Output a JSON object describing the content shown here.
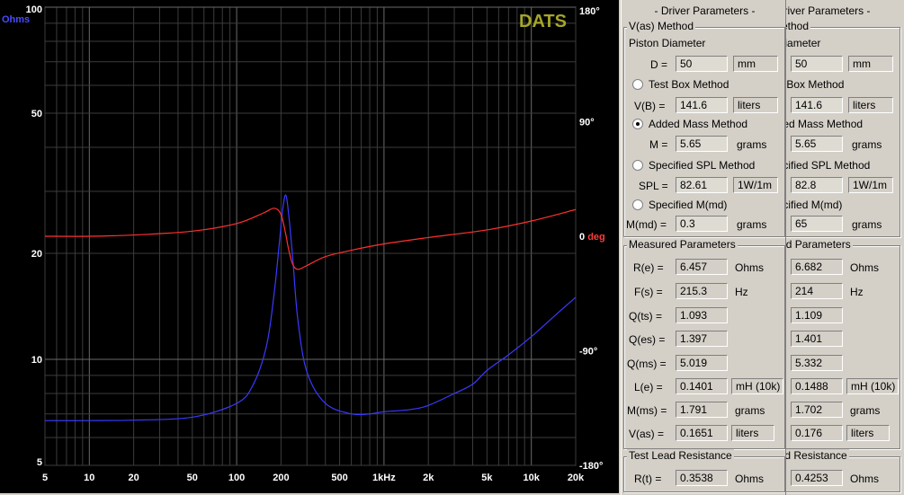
{
  "chart": {
    "logo": "DATS",
    "left_unit": "Ohms",
    "left_ticks": [
      "100",
      "50",
      "20",
      "10",
      "5"
    ],
    "right_ticks": [
      "180°",
      "90°",
      "0 deg",
      "-90°",
      "-180°"
    ],
    "x_ticks": [
      "5",
      "10",
      "20",
      "50",
      "100",
      "200",
      "500",
      "1kHz",
      "2k",
      "5k",
      "10k",
      "20k"
    ]
  },
  "chart_data": {
    "type": "line",
    "xlabel": "",
    "ylabel": "Ohms",
    "x_scale": "log",
    "y_scale": "log",
    "xlim": [
      5,
      20000
    ],
    "ylim": [
      5,
      100
    ],
    "y2lim": [
      -180,
      180
    ],
    "series": [
      {
        "axis": "left",
        "color": "#3a3aff",
        "x": [
          5,
          10,
          20,
          50,
          100,
          130,
          160,
          180,
          195,
          205,
          215,
          225,
          240,
          260,
          300,
          400,
          600,
          800,
          1000,
          1500,
          2000,
          3000,
          4000,
          5000,
          7000,
          10000,
          15000,
          20000
        ],
        "y": [
          6.7,
          6.7,
          6.72,
          6.85,
          7.5,
          8.5,
          11,
          15.5,
          21.5,
          26.5,
          29.3,
          26,
          19.5,
          13,
          9.2,
          7.5,
          7.0,
          7.0,
          7.1,
          7.2,
          7.4,
          8.0,
          8.5,
          9.3,
          10.3,
          11.6,
          13.5,
          15.0
        ]
      },
      {
        "axis": "right",
        "color": "#ff3030",
        "x": [
          5,
          10,
          20,
          50,
          100,
          150,
          180,
          200,
          215,
          225,
          240,
          260,
          300,
          400,
          600,
          1000,
          2000,
          5000,
          10000,
          20000
        ],
        "y": [
          0,
          0,
          1,
          4,
          10,
          18,
          22,
          17,
          2,
          -10,
          -22,
          -26,
          -23,
          -16,
          -11,
          -6,
          -1,
          5,
          12,
          21
        ]
      }
    ]
  },
  "params": {
    "title": "- Driver Parameters -",
    "vas_method": "V(as) Method",
    "piston_diameter": "Piston Diameter",
    "d_label": "D =",
    "d_unit": "mm",
    "test_box": "Test Box Method",
    "vb_label": "V(B) =",
    "vb_unit": "liters",
    "added_mass": "Added Mass Method",
    "m_label": "M =",
    "m_unit": "grams",
    "spl_method": "Specified SPL Method",
    "spl_label": "SPL =",
    "spl_unit": "1W/1m",
    "specified_m": "Specified M(md)",
    "mmd_label": "M(md) =",
    "mmd_unit": "grams",
    "measured": "Measured Parameters",
    "re_label": "R(e) =",
    "re_unit": "Ohms",
    "fs_label": "F(s) =",
    "fs_unit": "Hz",
    "qts_label": "Q(ts) =",
    "qes_label": "Q(es) =",
    "qms_label": "Q(ms) =",
    "le_label": "L(e) =",
    "le_unit": "mH (10k)",
    "mms_label": "M(ms) =",
    "mms_unit": "grams",
    "vas_label": "V(as) =",
    "vas_unit": "liters",
    "test_lead": "Test Lead Resistance",
    "rt_label": "R(t) =",
    "rt_unit": "Ohms"
  },
  "panel1_values": {
    "d": "50",
    "vb": "141.6",
    "m": "5.65",
    "spl": "82.61",
    "mmd": "0.3",
    "re": "6.457",
    "fs": "215.3",
    "qts": "1.093",
    "qes": "1.397",
    "qms": "5.019",
    "le": "0.1401",
    "mms": "1.791",
    "vas": "0.1651",
    "rt": "0.3538"
  },
  "panel2_values": {
    "d": "50",
    "vb": "141.6",
    "m": "5.65",
    "spl": "82.8",
    "mmd": "65",
    "re": "6.682",
    "fs": "214",
    "qts": "1.109",
    "qes": "1.401",
    "qms": "5.332",
    "le": "0.1488",
    "mms": "1.702",
    "vas": "0.176",
    "rt": "0.4253"
  }
}
